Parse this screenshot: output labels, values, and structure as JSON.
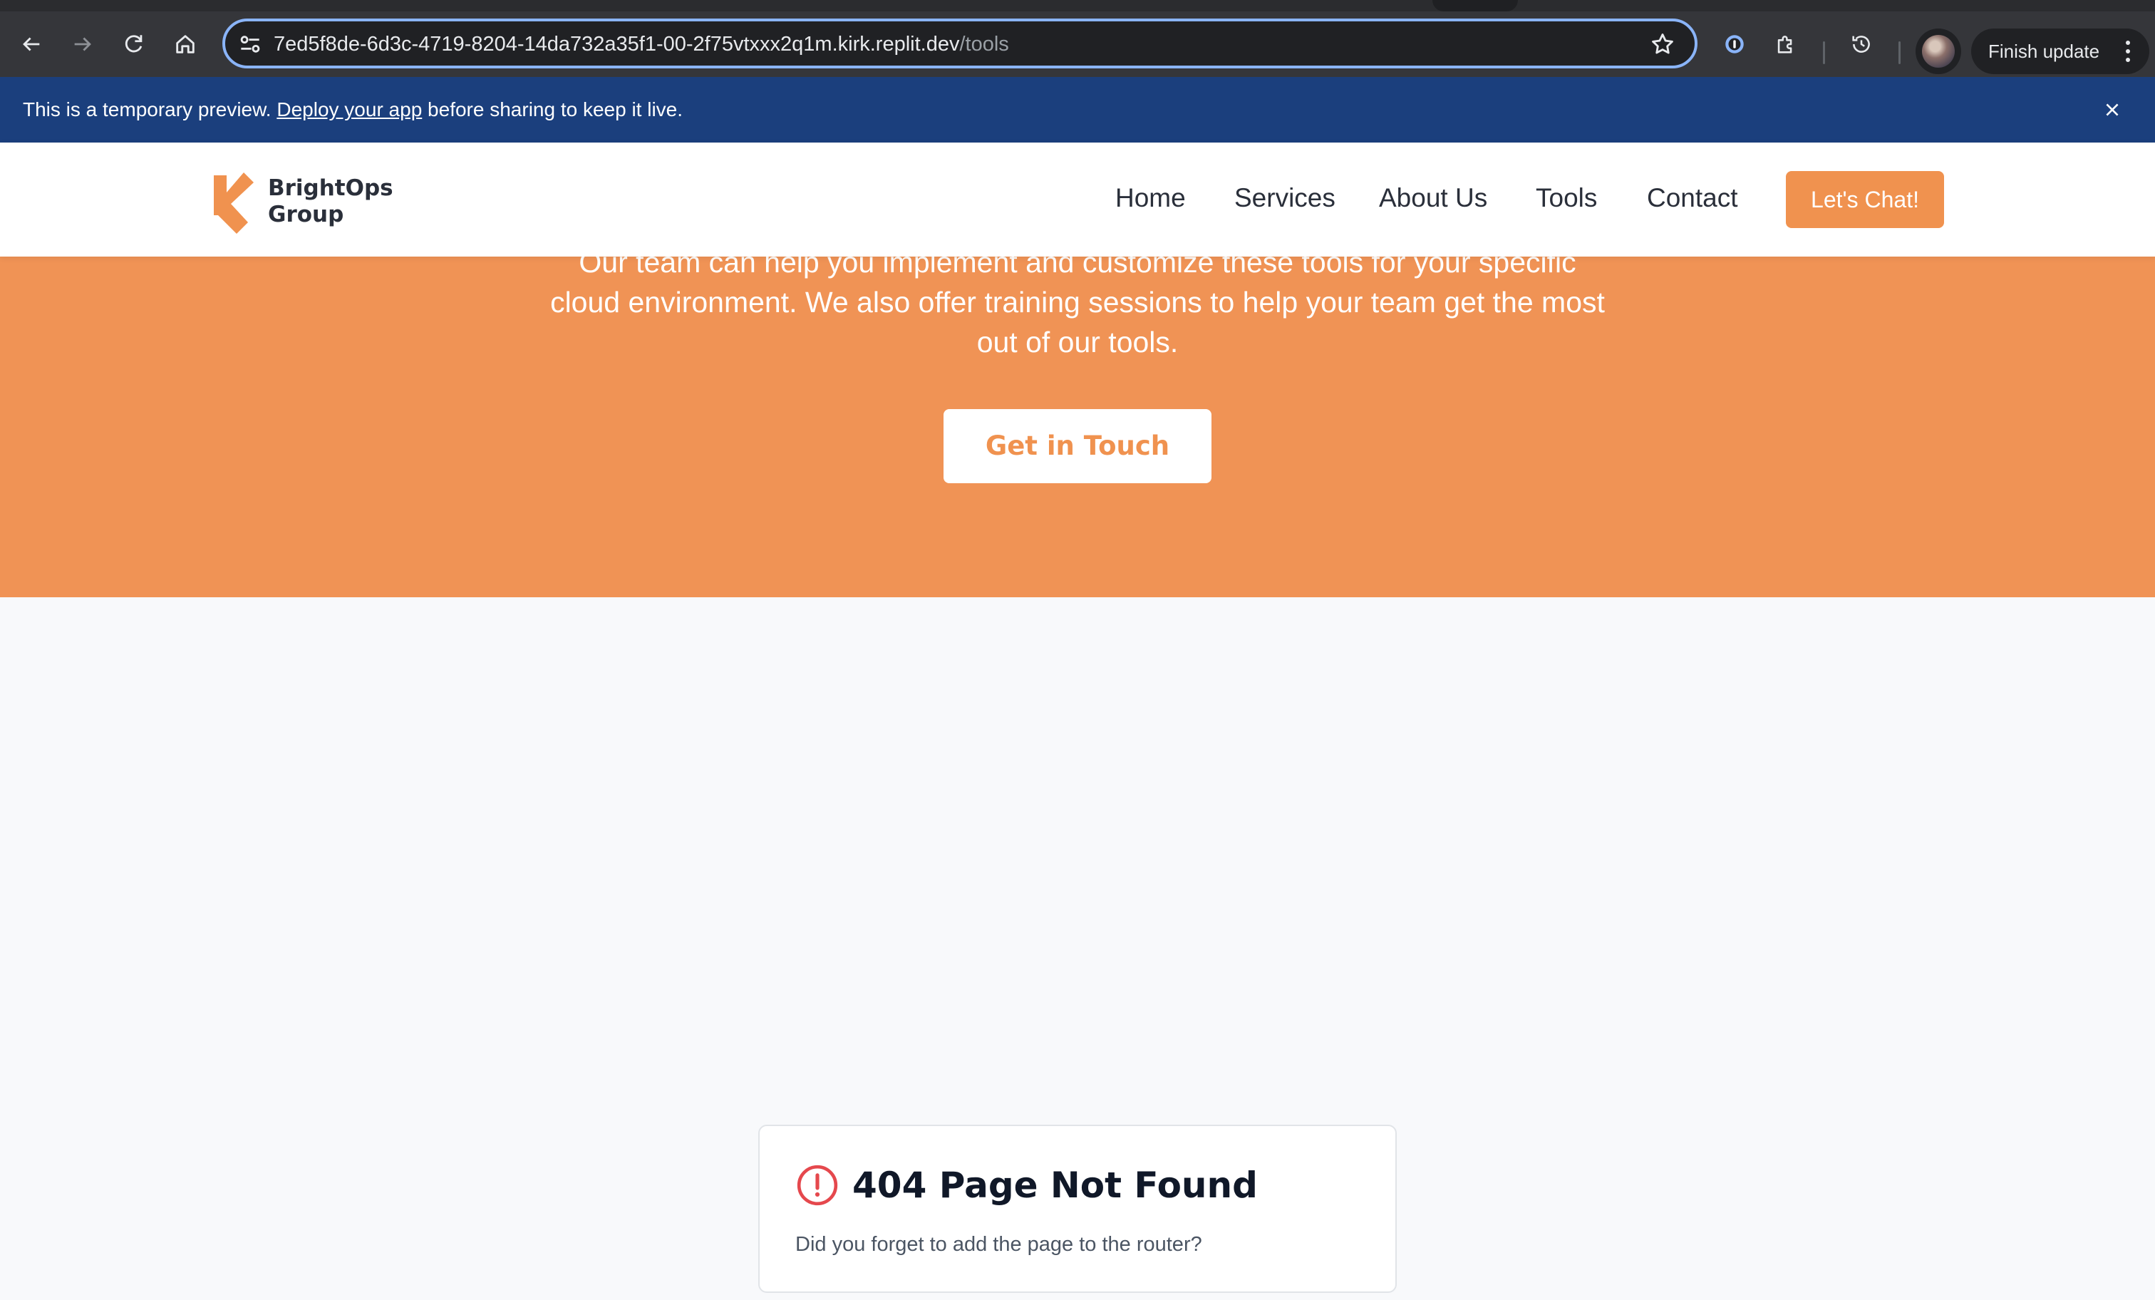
{
  "browser": {
    "url_host": "7ed5f8de-6d3c-4719-8204-14da732a35f1-00-2f75vtxxx2q1m.kirk.replit.dev",
    "url_path": "/tools",
    "finish_update_label": "Finish update",
    "icons": [
      "back-icon",
      "forward-icon",
      "reload-icon",
      "home-icon",
      "site-settings-icon",
      "bookmark-star-icon",
      "password-manager-icon",
      "extensions-icon",
      "history-icon",
      "profile-avatar",
      "more-vert-icon"
    ]
  },
  "preview_banner": {
    "text_before": "This is a temporary preview.",
    "link_text": "Deploy your app",
    "text_after": "before sharing to keep it live.",
    "background": "#1b3f7d"
  },
  "site": {
    "logo": {
      "line1": "BrightOps",
      "line2": "Group"
    },
    "nav": [
      {
        "label": "Home"
      },
      {
        "label": "Services"
      },
      {
        "label": "About Us"
      },
      {
        "label": "Tools"
      },
      {
        "label": "Contact"
      }
    ],
    "chat_button": "Let's Chat!",
    "accent": "#f0924f"
  },
  "cta": {
    "lines": [
      "Our team can help you implement and customize these tools for your specific",
      "cloud environment. We also offer training sessions to help your team get the most",
      "out of our tools."
    ],
    "button": "Get in Touch"
  },
  "not_found": {
    "title": "404 Page Not Found",
    "message": "Did you forget to add the page to the router?",
    "icon_color": "#e5484d"
  }
}
